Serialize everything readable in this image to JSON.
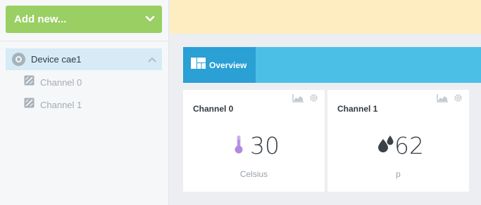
{
  "sidebar": {
    "add_button_label": "Add new...",
    "device": {
      "name": "Device cae1"
    },
    "channels": [
      {
        "label": "Channel 0"
      },
      {
        "label": "Channel 1"
      }
    ]
  },
  "tabs": [
    {
      "label": "Overview"
    }
  ],
  "widgets": [
    {
      "title": "Channel 0",
      "icon": "thermometer-icon",
      "value": "30",
      "unit": "Celsius",
      "accent": "#b189e0"
    },
    {
      "title": "Channel 1",
      "icon": "water-drop-icon",
      "value": "62",
      "unit": "p",
      "accent": "#3b4147"
    }
  ],
  "colors": {
    "add_button": "#99cf63",
    "selected_row": "#d6ebf6",
    "banner": "#fdedc0",
    "tabbar": "#4bbfe6",
    "active_tab": "#2aa0d4"
  }
}
